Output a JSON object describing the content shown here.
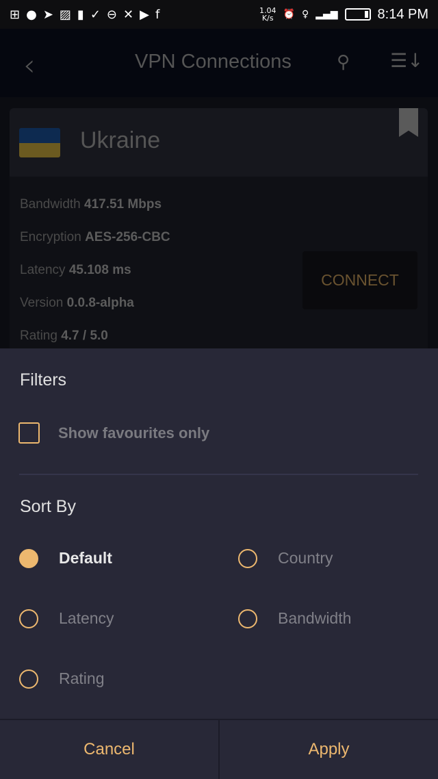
{
  "status_bar": {
    "speed_value": "1.04",
    "speed_unit": "K/s",
    "time": "8:14 PM",
    "icons": [
      "plus-box",
      "messenger",
      "telegram",
      "image",
      "battery-alert",
      "download-done",
      "chat-bubble",
      "x",
      "youtube",
      "facebook"
    ]
  },
  "appbar": {
    "title": "VPN Connections",
    "back_icon": "chevron-left",
    "search_icon": "search",
    "sort_icon": "sort"
  },
  "server": {
    "country": "Ukraine",
    "flag_colors": [
      "#0d2a50",
      "#6b5a20"
    ],
    "bandwidth_label": "Bandwidth",
    "bandwidth": "417.51 Mbps",
    "encryption_label": "Encryption",
    "encryption": "AES-256-CBC",
    "latency_label": "Latency",
    "latency": "45.108 ms",
    "version_label": "Version",
    "version": "0.0.8-alpha",
    "rating_label": "Rating",
    "rating": "4.7 / 5.0",
    "connect_label": "CONNECT"
  },
  "sheet": {
    "filters_title": "Filters",
    "favourites_label": "Show favourites only",
    "favourites_checked": false,
    "sort_title": "Sort By",
    "options": [
      {
        "label": "Default",
        "selected": true
      },
      {
        "label": "Country",
        "selected": false
      },
      {
        "label": "Latency",
        "selected": false
      },
      {
        "label": "Bandwidth",
        "selected": false
      },
      {
        "label": "Rating",
        "selected": false
      }
    ],
    "cancel_label": "Cancel",
    "apply_label": "Apply"
  },
  "colors": {
    "accent": "#edb86f",
    "sheet": "#282837"
  }
}
